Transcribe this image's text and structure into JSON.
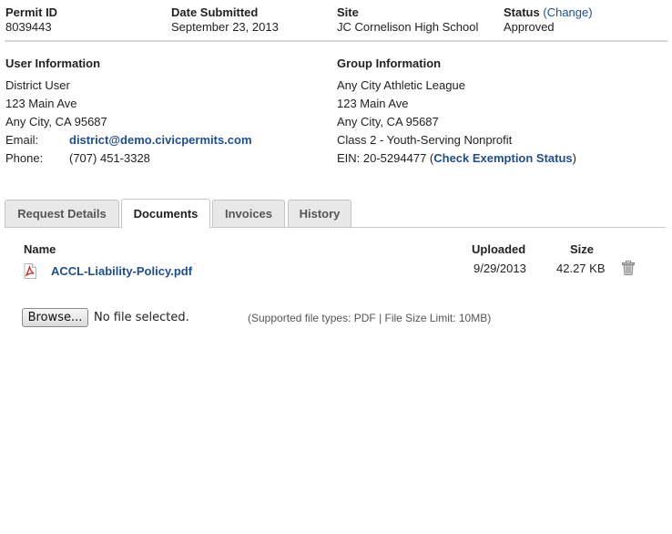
{
  "header": {
    "permit_id_label": "Permit ID",
    "permit_id": "8039443",
    "date_label": "Date Submitted",
    "date": "September 23, 2013",
    "site_label": "Site",
    "site": "JC Cornelison High School",
    "status_label": "Status",
    "status_open": "(",
    "status_change": "Change",
    "status_close": ")",
    "status": "Approved"
  },
  "user_info": {
    "title": "User Information",
    "name": "District User",
    "address1": "123 Main Ave",
    "address2": "Any City, CA 95687",
    "email_label": "Email:",
    "email": "district@demo.civicpermits.com",
    "phone_label": "Phone:",
    "phone": "(707) 451-3328"
  },
  "group_info": {
    "title": "Group Information",
    "name": "Any City Athletic League",
    "address1": "123 Main Ave",
    "address2": "Any City, CA 95687",
    "class": "Class 2 - Youth-Serving Nonprofit",
    "ein_prefix": "EIN: 20-5294477 (",
    "ein_link": "Check Exemption Status",
    "ein_suffix": ")"
  },
  "tabs": [
    {
      "label": "Request Details",
      "active": false
    },
    {
      "label": "Documents",
      "active": true
    },
    {
      "label": "Invoices",
      "active": false
    },
    {
      "label": "History",
      "active": false
    }
  ],
  "documents": {
    "col_name": "Name",
    "col_uploaded": "Uploaded",
    "col_size": "Size",
    "rows": [
      {
        "name": "ACCL-Liability-Policy.pdf",
        "uploaded": "9/29/2013",
        "size": "42.27 KB",
        "icon": "pdf-icon"
      }
    ]
  },
  "upload": {
    "browse_label": "Browse...",
    "no_file": "No file selected.",
    "hint": "(Supported file types: PDF | File Size Limit: 10MB)"
  },
  "colors": {
    "link": "#1f4e8c",
    "pdf_red": "#c8261e"
  }
}
